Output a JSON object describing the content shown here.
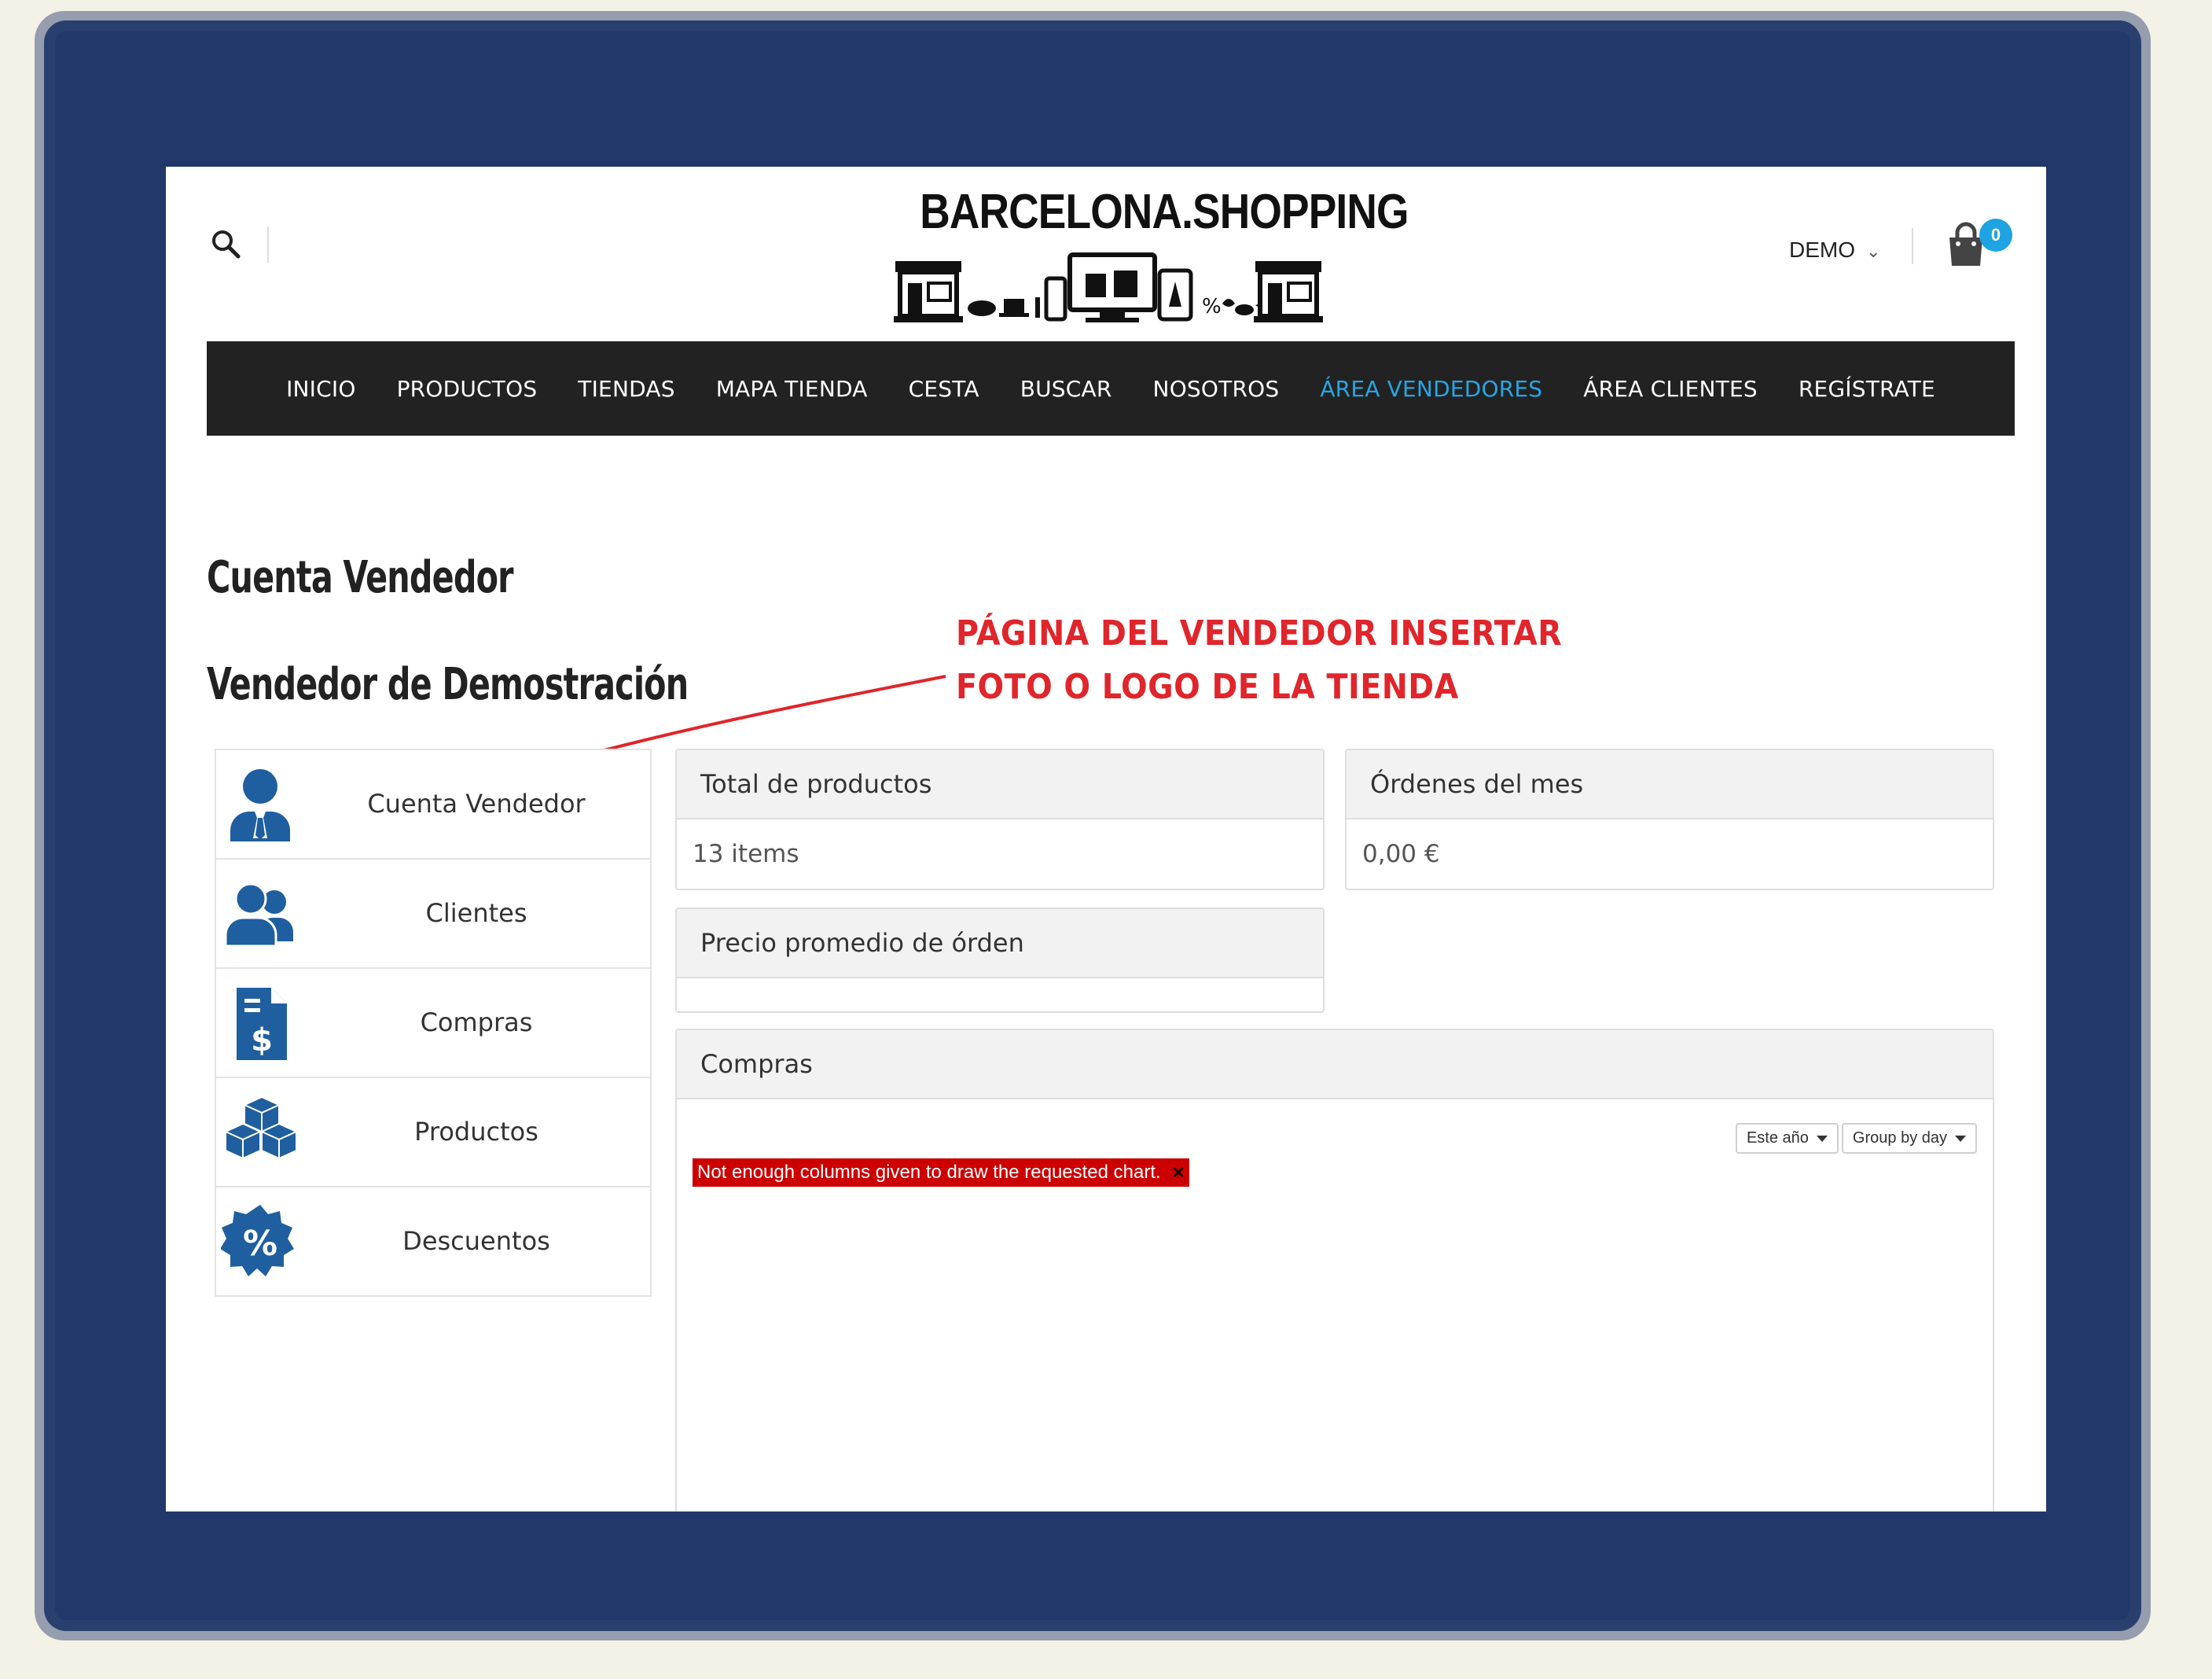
{
  "header": {
    "logo_text": "BARCELONA.SHOPPING",
    "user_label": "DEMO",
    "cart_count": "0"
  },
  "nav": {
    "items": [
      {
        "label": "INICIO"
      },
      {
        "label": "PRODUCTOS"
      },
      {
        "label": "TIENDAS"
      },
      {
        "label": "MAPA TIENDA"
      },
      {
        "label": "CESTA"
      },
      {
        "label": "BUSCAR"
      },
      {
        "label": "NOSOTROS"
      },
      {
        "label": "ÁREA VENDEDORES",
        "active": true
      },
      {
        "label": "ÁREA CLIENTES"
      },
      {
        "label": "REGÍSTRATE"
      }
    ]
  },
  "page": {
    "title": "Cuenta Vendedor",
    "subtitle": "Vendedor de Demostración"
  },
  "annotation": {
    "line1": "PÁGINA DEL VENDEDOR INSERTAR",
    "line2": "FOTO O LOGO DE LA TIENDA"
  },
  "sidebar": {
    "items": [
      {
        "label": "Cuenta Vendedor",
        "icon": "vendor-account-icon"
      },
      {
        "label": "Clientes",
        "icon": "customers-icon"
      },
      {
        "label": "Compras",
        "icon": "invoice-icon"
      },
      {
        "label": "Productos",
        "icon": "boxes-icon"
      },
      {
        "label": "Descuentos",
        "icon": "discount-badge-icon"
      }
    ]
  },
  "stats": {
    "total_products": {
      "title": "Total de productos",
      "value": "13 items"
    },
    "monthly_orders": {
      "title": "Órdenes del mes",
      "value": "0,00 €"
    },
    "avg_order_price": {
      "title": "Precio promedio de órden",
      "value": ""
    }
  },
  "purchases": {
    "title": "Compras",
    "period_select": "Este año",
    "group_select": "Group by day",
    "error_message": "Not enough columns given to draw the requested chart."
  },
  "colors": {
    "frame": "#22386a",
    "nav_bg": "#222222",
    "accent": "#26a6e4",
    "icon_blue": "#1f5fa0",
    "annotation_red": "#e0252b",
    "error_red": "#cc0000"
  }
}
